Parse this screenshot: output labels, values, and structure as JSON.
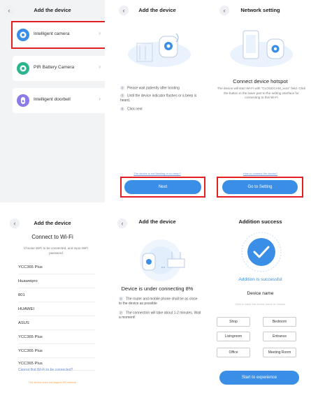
{
  "colors": {
    "accent": "#3a8ee6",
    "highlight": "#e02020",
    "link": "#6b8fd6",
    "warning": "#f0a050"
  },
  "panel1": {
    "title": "Add the device",
    "devices": [
      {
        "label": "Intelligent camera",
        "icon": "camera-icon",
        "color": "#3a8ee6"
      },
      {
        "label": "PIR Battery Camera",
        "icon": "pir-camera-icon",
        "color": "#2bb58e"
      },
      {
        "label": "Intelligent doorbell",
        "icon": "doorbell-icon",
        "color": "#8a7be6"
      }
    ]
  },
  "panel2": {
    "title": "Add the device",
    "steps": [
      {
        "num": "1",
        "text": "Please wait patiently after booting"
      },
      {
        "num": "2",
        "text": "Until the device indicator flashes or a beep is heard,"
      },
      {
        "num": "3",
        "text": "Click next"
      }
    ],
    "help_link": "The device is not flashing or no beep?",
    "next_button": "Next"
  },
  "panel3": {
    "title": "Network setting",
    "heading": "Connect device hotspot",
    "description": "The device will start Wi-Fi with \"CLOUDCAM_xxxx\" field. Click the button in the lower part to the setting interface for connecting to this Wi-Fi",
    "help_link": "How to connect the device?",
    "go_button": "Go to Setting"
  },
  "panel4": {
    "title": "Add the device",
    "heading": "Connect to Wi-Fi",
    "subtitle": "Choose WiFi to be connected, and input WiFi password",
    "networks": [
      "YCC365 Plus",
      "Huaweipro",
      "801",
      "HUAWEI",
      "ASUS",
      "YCC365 Plus",
      "YCC365 Plus",
      "YCC365 Plus"
    ],
    "cannot_find": "Cannot find Wi-Fi to be connected?",
    "note": "The device does not support 5G network"
  },
  "panel5": {
    "title": "Add the device",
    "heading": "Device is under connecting 8%",
    "progress_percent": 8,
    "notes": [
      {
        "num": "1",
        "text": "The router and mobile phone shall be as close to the device as possible"
      },
      {
        "num": "2",
        "text": "The connection will take about 1-2 minutes. Wait a moment!"
      }
    ]
  },
  "panel6": {
    "title": "Addition success",
    "success_text": "Addition is successful",
    "device_name_label": "Device name",
    "name_placeholder": "Click to input the device name or choose",
    "rooms": [
      "Shop",
      "Bedroom",
      "Livingroom",
      "Entrance",
      "Office",
      "Meeting Room"
    ],
    "start_button": "Start to experience"
  }
}
